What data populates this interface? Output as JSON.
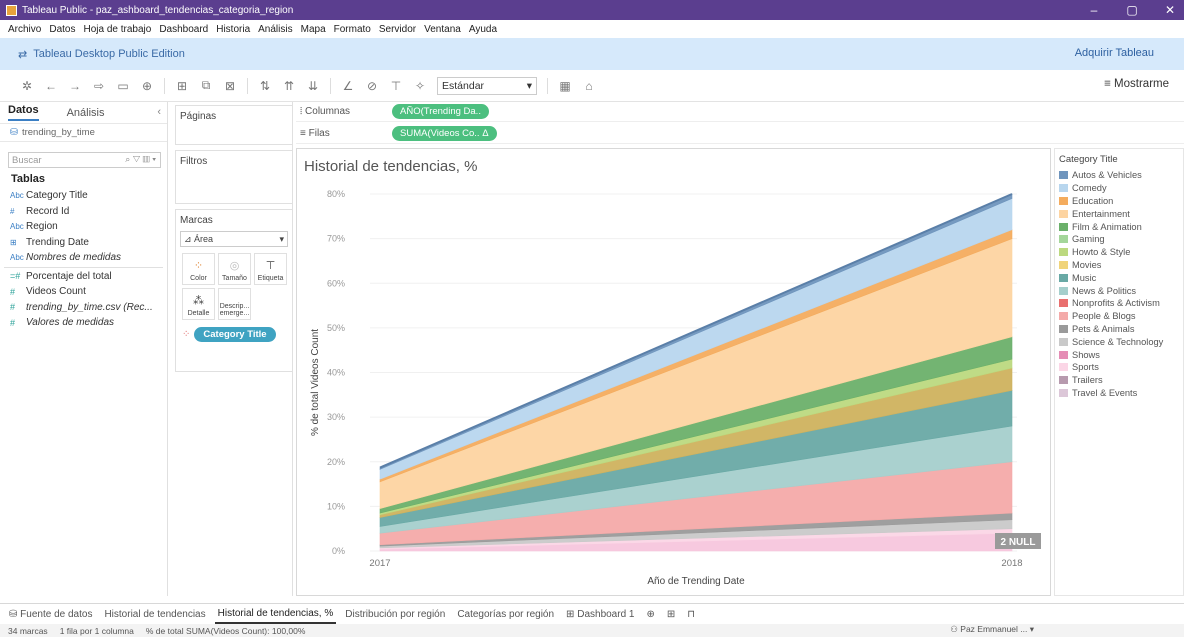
{
  "window": {
    "title": "Tableau Public - paz_ashboard_tendencias_categoria_region",
    "controls": [
      "–",
      "▢",
      "✕"
    ]
  },
  "menu": [
    "Archivo",
    "Datos",
    "Hoja de trabajo",
    "Dashboard",
    "Historia",
    "Análisis",
    "Mapa",
    "Formato",
    "Servidor",
    "Ventana",
    "Ayuda"
  ],
  "edition": {
    "label": "Tableau Desktop Public Edition",
    "acquire": "Adquirir Tableau"
  },
  "toolbar": {
    "fit_value": "Estándar",
    "show_me": "Mostrarme"
  },
  "data_pane": {
    "tab_data": "Datos",
    "tab_analysis": "Análisis",
    "source": "trending_by_time",
    "search_placeholder": "Buscar",
    "tables_heading": "Tablas",
    "fields": [
      {
        "type": "Abc",
        "name": "Category Title",
        "italic": false
      },
      {
        "type": "#",
        "name": "Record Id",
        "italic": false
      },
      {
        "type": "Abc",
        "name": "Region",
        "italic": false
      },
      {
        "type": "⊞",
        "name": "Trending Date",
        "italic": false
      },
      {
        "type": "Abc",
        "name": "Nombres de medidas",
        "italic": true
      }
    ],
    "measures": [
      {
        "type": "=#",
        "name": "Porcentaje del total",
        "italic": false
      },
      {
        "type": "#",
        "name": "Videos Count",
        "italic": false
      },
      {
        "type": "#",
        "name": "trending_by_time.csv (Rec...",
        "italic": true
      },
      {
        "type": "#",
        "name": "Valores de medidas",
        "italic": true
      }
    ]
  },
  "shelves": {
    "pages": "Páginas",
    "filters": "Filtros",
    "marks": "Marcas",
    "mark_type": "Área",
    "color": "Color",
    "size": "Tamaño",
    "label": "Etiqueta",
    "detail": "Detalle",
    "tooltip": "Descrip... emerge...",
    "color_pill": "Category Title",
    "columns_label": "Columnas",
    "columns_pill": "AÑO(Trending Da..",
    "rows_label": "Filas",
    "rows_pill": "SUMA(Videos Co.. Δ"
  },
  "chart_data": {
    "type": "area",
    "title": "Historial de tendencias, %",
    "xlabel": "Año de Trending Date",
    "ylabel": "% de total Videos Count",
    "x": [
      "2017",
      "2018"
    ],
    "ylim": [
      0,
      80
    ],
    "yticks": [
      "0%",
      "10%",
      "20%",
      "30%",
      "40%",
      "50%",
      "60%",
      "70%",
      "80%"
    ],
    "stacked": true,
    "null_badge": "2 NULL",
    "series": [
      {
        "name": "Shows",
        "color": "#f7c6dd",
        "values": [
          0.4,
          4.0
        ]
      },
      {
        "name": "Sports",
        "color": "#fbd6e6",
        "values": [
          0.3,
          1.0
        ]
      },
      {
        "name": "Science & Technology",
        "color": "#c9c9c9",
        "values": [
          0.4,
          2.0
        ]
      },
      {
        "name": "Pets & Animals",
        "color": "#9a9a9a",
        "values": [
          0.3,
          1.5
        ]
      },
      {
        "name": "People & Blogs",
        "color": "#f4aaa9",
        "values": [
          2.6,
          11.5
        ]
      },
      {
        "name": "News & Politics",
        "color": "#a5cfcc",
        "values": [
          1.5,
          8.0
        ]
      },
      {
        "name": "Music",
        "color": "#69a9a5",
        "values": [
          2.0,
          8.0
        ]
      },
      {
        "name": "Movies",
        "color": "#cfb25e",
        "values": [
          0.6,
          5.0
        ]
      },
      {
        "name": "Howto & Style",
        "color": "#bcd97f",
        "values": [
          0.4,
          2.0
        ]
      },
      {
        "name": "Film & Animation",
        "color": "#6bb06a",
        "values": [
          1.0,
          5.0
        ]
      },
      {
        "name": "Entertainment",
        "color": "#fdd4a1",
        "values": [
          6.0,
          22.0
        ]
      },
      {
        "name": "Education",
        "color": "#f4ac5e",
        "values": [
          0.6,
          2.0
        ]
      },
      {
        "name": "Comedy",
        "color": "#b8d6ee",
        "values": [
          2.2,
          7.0
        ]
      },
      {
        "name": "Autos & Vehicles",
        "color": "#6f95bd",
        "values": [
          0.4,
          1.0
        ]
      }
    ]
  },
  "legend": {
    "title": "Category Title",
    "items": [
      {
        "name": "Autos & Vehicles",
        "color": "#6f95bd"
      },
      {
        "name": "Comedy",
        "color": "#b8d6ee"
      },
      {
        "name": "Education",
        "color": "#f4ac5e"
      },
      {
        "name": "Entertainment",
        "color": "#fdd4a1"
      },
      {
        "name": "Film & Animation",
        "color": "#6bb06a"
      },
      {
        "name": "Gaming",
        "color": "#a4d69a"
      },
      {
        "name": "Howto & Style",
        "color": "#bcd97f"
      },
      {
        "name": "Movies",
        "color": "#f0d47a"
      },
      {
        "name": "Music",
        "color": "#69a9a5"
      },
      {
        "name": "News & Politics",
        "color": "#a5cfcc"
      },
      {
        "name": "Nonprofits & Activism",
        "color": "#e96f6e"
      },
      {
        "name": "People & Blogs",
        "color": "#f4aaa9"
      },
      {
        "name": "Pets & Animals",
        "color": "#9a9a9a"
      },
      {
        "name": "Science & Technology",
        "color": "#c9c9c9"
      },
      {
        "name": "Shows",
        "color": "#e58db5"
      },
      {
        "name": "Sports",
        "color": "#fbd6e6"
      },
      {
        "name": "Trailers",
        "color": "#b79aae"
      },
      {
        "name": "Travel & Events",
        "color": "#dcc7d8"
      }
    ]
  },
  "sheet_tabs": [
    "Fuente de datos",
    "Historial de tendencias",
    "Historial de tendencias, %",
    "Distribución por región",
    "Categorías por región",
    "Dashboard 1"
  ],
  "active_tab": "Historial de tendencias, %",
  "status": {
    "marks": "34 marcas",
    "rows_cols": "1 fila por 1 columna",
    "sum": "% de total SUMA(Videos Count): 100,00%",
    "user": "Paz Emmanuel ... ▾"
  }
}
